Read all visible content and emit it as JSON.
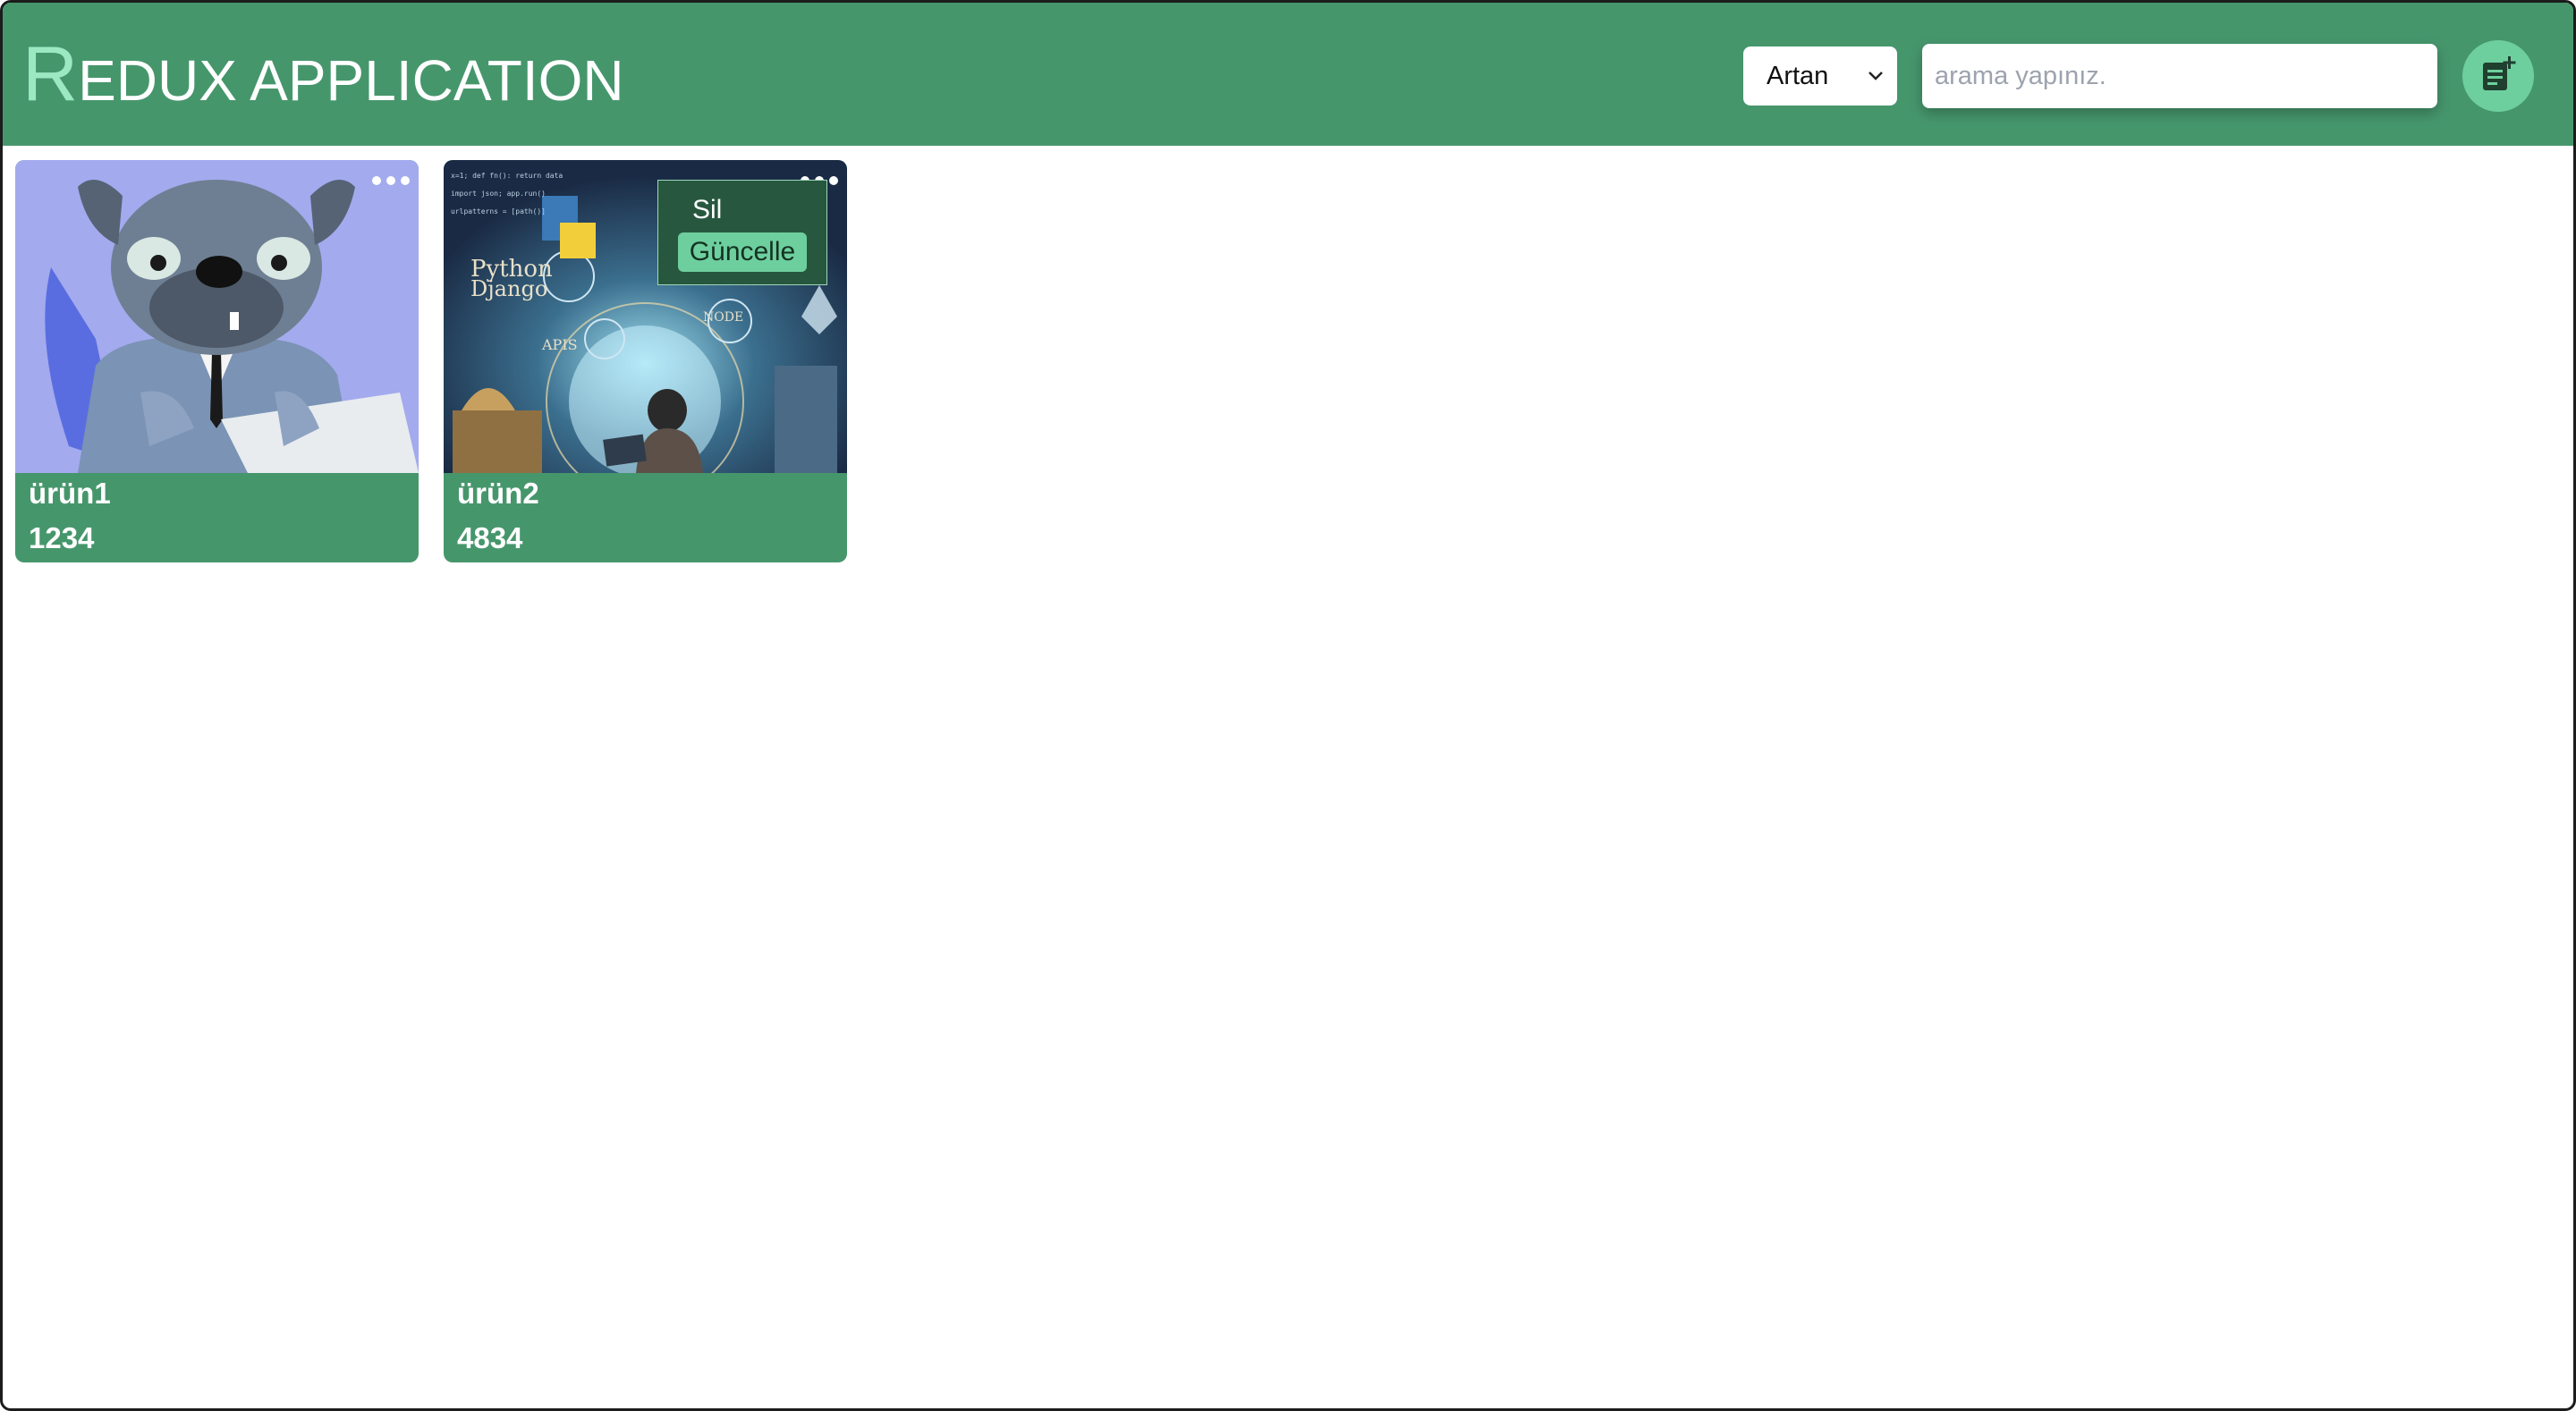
{
  "header": {
    "logo_first": "R",
    "logo_rest": "EDUX APPLICATION",
    "sort_value": "Artan",
    "search_placeholder": "arama yapınız.",
    "add_icon": "note-add-icon"
  },
  "colors": {
    "header_bg": "#46966c",
    "accent": "#6ecf9e",
    "menu_bg": "#27583f"
  },
  "products": [
    {
      "name": "ürün1",
      "price": "1234",
      "image": "cartoon-bulldog-at-keyboard"
    },
    {
      "name": "ürün2",
      "price": "4834",
      "image": "python-django-developer-illustration"
    }
  ],
  "context_menu": {
    "delete_label": "Sil",
    "update_label": "Güncelle"
  }
}
